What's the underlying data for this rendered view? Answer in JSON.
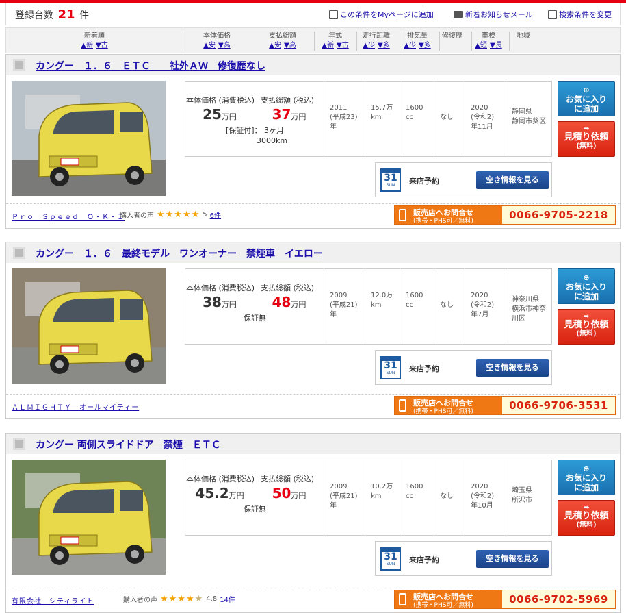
{
  "header": {
    "count_label": "登録台数",
    "count_value": "21",
    "count_unit": "件",
    "links": [
      {
        "label": "この条件をMyページに追加",
        "icon": "add-page-icon"
      },
      {
        "label": "新着お知らせメール",
        "icon": "mail-icon"
      },
      {
        "label": "検索条件を変更",
        "icon": "search-edit-icon"
      }
    ]
  },
  "sortbar": [
    {
      "label": "新着順",
      "a1": "▲新",
      "a2": "▼古"
    },
    {
      "label": "本体価格",
      "a1": "▲安",
      "a2": "▼高"
    },
    {
      "label": "支払総額",
      "a1": "▲安",
      "a2": "▼高"
    },
    {
      "label": "年式",
      "a1": "▲新",
      "a2": "▼古"
    },
    {
      "label": "走行距離",
      "a1": "▲少",
      "a2": "▼多"
    },
    {
      "label": "排気量",
      "a1": "▲少",
      "a2": "▼多"
    },
    {
      "label": "修復歴",
      "a1": "",
      "a2": ""
    },
    {
      "label": "車検",
      "a1": "▲短",
      "a2": "▼長"
    },
    {
      "label": "地域",
      "a1": "",
      "a2": ""
    }
  ],
  "common": {
    "price_label": "本体価格 (消費税込)",
    "total_label": "支払総額 (税込)",
    "unit": "万円",
    "visit_label": "来店予約",
    "visit_button": "空き情報を見る",
    "cal_day": "31",
    "cal_week": "SUN",
    "fav_button_line1": "お気に入り",
    "fav_button_line2": "に追加",
    "fav_icon": "car-add-icon",
    "est_button_line1": "見積り依頼",
    "est_button_line2": "(無料)",
    "est_icon": "arrow-icon",
    "contact_line1": "販売店へお問合せ",
    "contact_line2": "(携帯・PHS可／無料)",
    "voice_label": "購入者の声"
  },
  "cars": [
    {
      "title": "カングー　１．６　ＥＴＣ　　社外ＡＷ　修復歴なし",
      "price": "25",
      "total": "37",
      "warranty_line1": "[保証付]： 3ヶ月",
      "warranty_line2": "3000km",
      "year": "2011",
      "year_jp": "(平成23)",
      "year_unit": "年",
      "mileage": "15.7万",
      "mileage_unit": "km",
      "displacement": "1600",
      "displacement_unit": "cc",
      "repair": "なし",
      "inspection": "2020",
      "inspection_jp": "(令和2)",
      "inspection_month": "年11月",
      "region1": "静岡県",
      "region2": "静岡市葵区",
      "region3": "",
      "dealer": "Ｐｒｏ　Ｓｐｅｅｄ　Ｏ・Ｋ・Ｉ",
      "has_voice": true,
      "rating": "5",
      "stars": "★★★★★",
      "stars_half": "",
      "reviews": "6件",
      "phone": "0066-9705-2218"
    },
    {
      "title": "カングー　１．６　最終モデル　ワンオーナー　禁煙車　イエロー",
      "price": "38",
      "total": "48",
      "warranty_line1": "保証無",
      "warranty_line2": "",
      "year": "2009",
      "year_jp": "(平成21)",
      "year_unit": "年",
      "mileage": "12.0万",
      "mileage_unit": "km",
      "displacement": "1600",
      "displacement_unit": "cc",
      "repair": "なし",
      "inspection": "2020",
      "inspection_jp": "(令和2)",
      "inspection_month": "年7月",
      "region1": "神奈川県",
      "region2": "横浜市神奈",
      "region3": "川区",
      "dealer": "ＡＬＭＩＧＨＴＹ　オールマイティー",
      "has_voice": false,
      "rating": "",
      "stars": "",
      "stars_half": "",
      "reviews": "",
      "phone": "0066-9706-3531"
    },
    {
      "title": "カングー 両側スライドドア　禁煙　ＥＴＣ",
      "price": "45.2",
      "total": "50",
      "warranty_line1": "保証無",
      "warranty_line2": "",
      "year": "2009",
      "year_jp": "(平成21)",
      "year_unit": "年",
      "mileage": "10.2万",
      "mileage_unit": "km",
      "displacement": "1600",
      "displacement_unit": "cc",
      "repair": "なし",
      "inspection": "2020",
      "inspection_jp": "(令和2)",
      "inspection_month": "年10月",
      "region1": "埼玉県",
      "region2": "所沢市",
      "region3": "",
      "dealer": "有限会社　シティライト",
      "has_voice": true,
      "rating": "4.8",
      "stars": "★★★★",
      "stars_half": "★",
      "reviews": "14件",
      "phone": "0066-9702-5969"
    }
  ],
  "colors": {
    "accent_red": "#e60012",
    "link_blue": "#1a0dab",
    "contact_orange": "#f07814",
    "fav_blue": "#1a6fae",
    "car_yellow": "#e8d94a"
  }
}
